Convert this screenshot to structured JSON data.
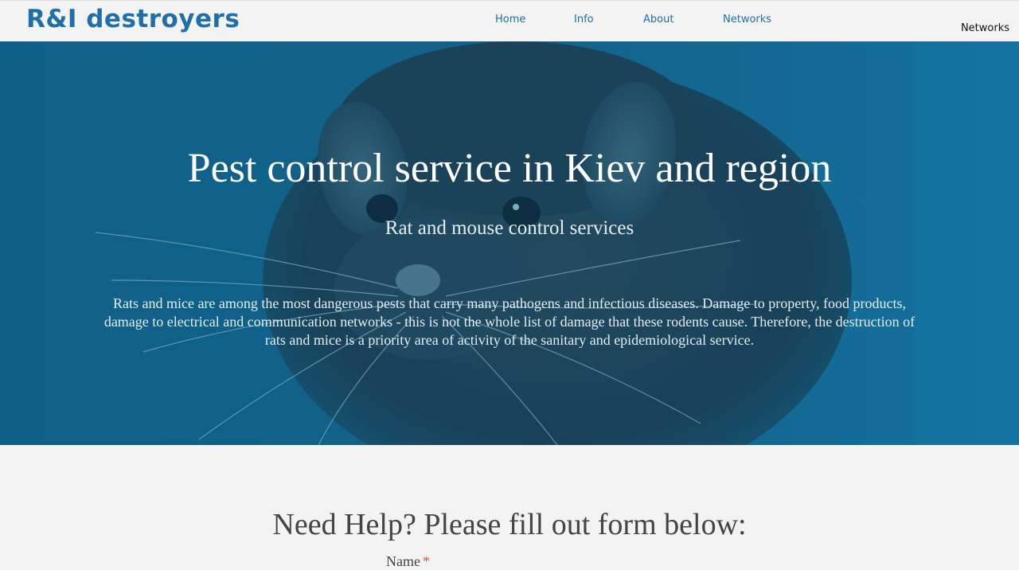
{
  "header": {
    "logo": "R&I destroyers",
    "nav": [
      "Home",
      "Info",
      "About",
      "Networks"
    ],
    "nav_extra": "Networks"
  },
  "hero": {
    "title": "Pest control service in Kiev and region",
    "subtitle": "Rat and mouse control services",
    "description": "Rats and mice are among the most dangerous pests that carry many pathogens and infectious diseases. Damage to property, food products, damage to electrical and communication networks - this is not the whole list of damage that these rodents cause. Therefore, the destruction of rats and mice is a priority area of activity of the sanitary and epidemiological service."
  },
  "form": {
    "heading": "Need Help? Please fill out form below:",
    "name_label": "Name",
    "required_mark": "*"
  },
  "colors": {
    "brand": "#1f6fa8",
    "hero_overlay": "#125f84",
    "required": "#d9534f"
  }
}
